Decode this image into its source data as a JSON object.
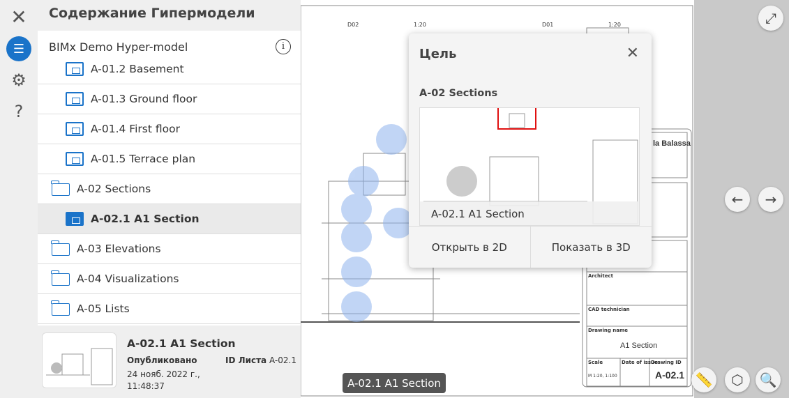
{
  "panel": {
    "title": "Содержание Гипермодели",
    "model": "BIMx Demo Hyper-model",
    "items": [
      {
        "label": "A-01.2 Basement"
      },
      {
        "label": "A-01.3 Ground floor"
      },
      {
        "label": "A-01.4 First floor"
      },
      {
        "label": "A-01.5 Terrace plan"
      },
      {
        "label": "A-02 Sections"
      },
      {
        "label": "A-02.1 A1 Section"
      },
      {
        "label": "A-03 Elevations"
      },
      {
        "label": "A-04 Visualizations"
      },
      {
        "label": "A-05 Lists"
      }
    ]
  },
  "footer": {
    "title": "A-02.1 A1 Section",
    "status": "Опубликовано",
    "id_label": "ID Листа",
    "id_value": "A-02.1",
    "date": "24 нояб. 2022 г.,",
    "time": "11:48:37"
  },
  "popup": {
    "title": "Цель",
    "section": "A-02 Sections",
    "caption": "A-02.1 A1 Section",
    "open2d": "Открыть в 2D",
    "show3d": "Показать в 3D"
  },
  "tooltip": "A-02.1 A1 Section",
  "drawing": {
    "labels": [
      "D02",
      "1:20",
      "D01",
      "1:20",
      "la Balassa",
      "Architect",
      "CAD technician",
      "Drawing name",
      "A1 Section",
      "Scale",
      "M 1:20, 1:100",
      "Date of issue",
      "Drawing ID",
      "A-02.1"
    ]
  }
}
